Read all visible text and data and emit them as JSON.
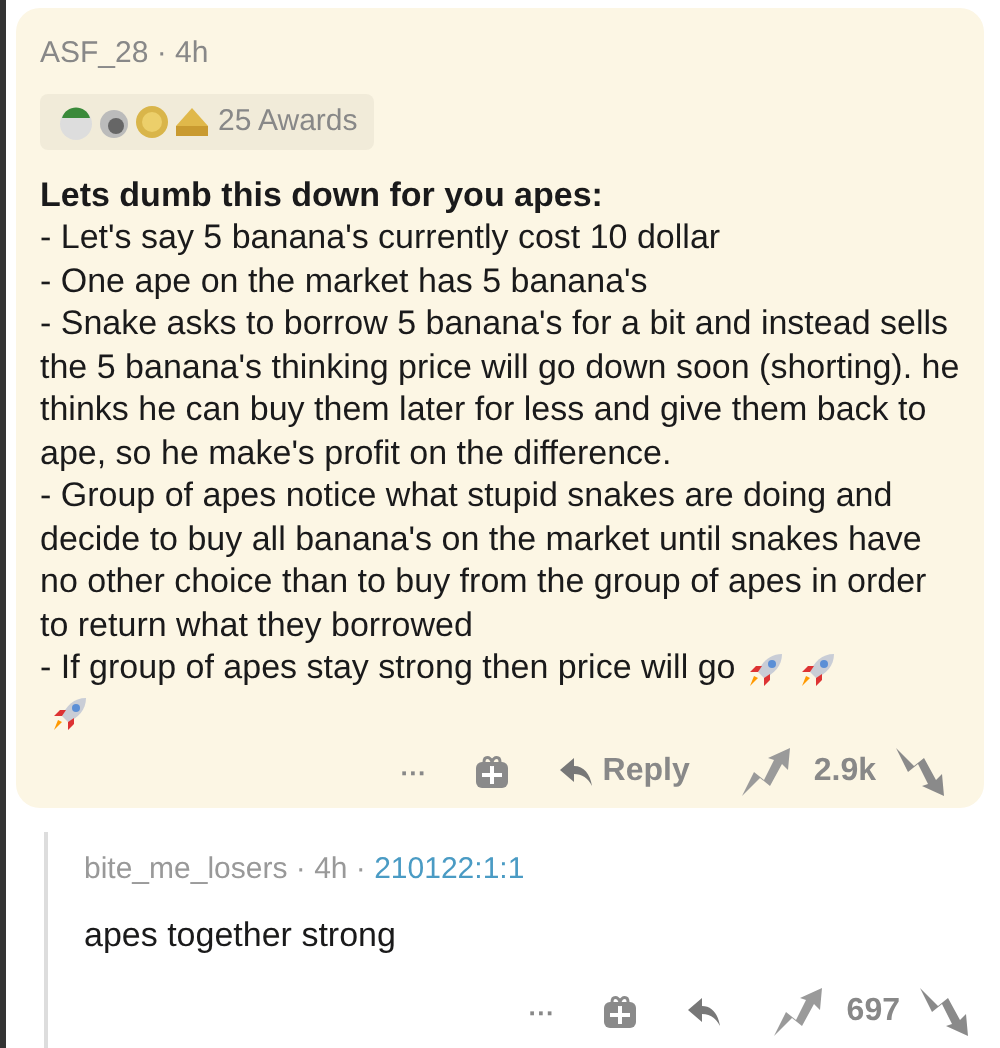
{
  "comment": {
    "author": "ASF_28",
    "separator": "·",
    "time": "4h",
    "awards": "25 Awards",
    "title": "Lets dumb this down for you apes:",
    "lines": [
      "- Let's say 5 banana's currently cost 10 dollar",
      "- One ape on the market has 5 banana's",
      "- Snake asks to borrow 5 banana's for a bit and instead sells the 5 banana's thinking price will go down soon (shorting). he thinks he can buy them later for less and give them back to ape, so he make's profit on the difference.",
      "- Group of apes notice what stupid snakes are doing and decide to buy all banana's on the market until snakes have no other choice than to buy from the group of apes in order to return what they borrowed",
      "- If group of apes stay strong then price will go"
    ],
    "more": "···",
    "reply": "Reply",
    "score": "2.9k"
  },
  "reply": {
    "author": "bite_me_losers",
    "separator": "·",
    "time": "4h",
    "separator_2": "·",
    "flair": "210122:1:1",
    "text": "apes together strong",
    "more": "···",
    "score": "697"
  }
}
